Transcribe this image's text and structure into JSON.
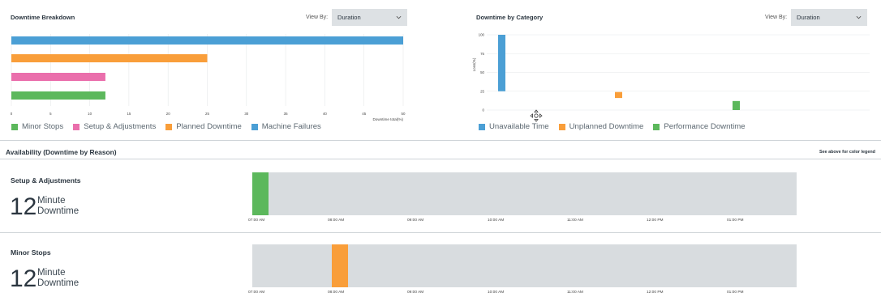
{
  "breakdown": {
    "title": "Downtime Breakdown",
    "view_by_label": "View By:",
    "view_by_value": "Duration",
    "chart_data": {
      "type": "bar",
      "orientation": "horizontal",
      "categories": [
        "Machine Failures",
        "Planned Downtime",
        "Setup & Adjustments",
        "Minor Stops"
      ],
      "values": [
        50,
        25,
        12,
        12
      ],
      "colors": [
        "#4b9fd5",
        "#f99e3a",
        "#ea6fac",
        "#5cb85c"
      ],
      "xlabel": "Downtime total(%)",
      "xlim": [
        0,
        50
      ],
      "xticks": [
        "0",
        "5",
        "10",
        "15",
        "20",
        "25",
        "30",
        "35",
        "40",
        "45",
        "50"
      ],
      "grid": true
    },
    "legend": [
      {
        "label": "Minor Stops",
        "color": "#5cb85c"
      },
      {
        "label": "Setup & Adjustments",
        "color": "#ea6fac"
      },
      {
        "label": "Planned Downtime",
        "color": "#f99e3a"
      },
      {
        "label": "Machine Failures",
        "color": "#4b9fd5"
      }
    ]
  },
  "category": {
    "title": "Downtime by Category",
    "view_by_label": "View By:",
    "view_by_value": "Duration",
    "chart_data": {
      "type": "bar",
      "series": [
        {
          "name": "Unavailable Time",
          "color": "#4b9fd5",
          "start": 25,
          "end": 100
        },
        {
          "name": "Unplanned Downtime",
          "color": "#f99e3a",
          "start": 16,
          "end": 24
        },
        {
          "name": "Performance Downtime",
          "color": "#5cb85c",
          "start": 0,
          "end": 12
        }
      ],
      "ylabel": "Loss(%)",
      "ylim": [
        0,
        100
      ],
      "yticks": [
        "100",
        "75",
        "50",
        "25",
        "0"
      ],
      "grid": true
    },
    "legend": [
      {
        "label": "Unavailable Time",
        "color": "#4b9fd5"
      },
      {
        "label": "Unplanned Downtime",
        "color": "#f99e3a"
      },
      {
        "label": "Performance Downtime",
        "color": "#5cb85c"
      }
    ]
  },
  "availability": {
    "title": "Availability (Downtime by Reason)",
    "legend_note": "See above for color legend",
    "time_labels": [
      "07:00 AM",
      "08:00 AM",
      "09:00 AM",
      "10:00 AM",
      "11:00 AM",
      "12:00 PM",
      "01:00 PM"
    ],
    "reasons": [
      {
        "name": "Setup & Adjustments",
        "value": "12",
        "unit_line1": "Minute",
        "unit_line2": "Downtime",
        "color": "#5cb85c",
        "start_hour": 7.0,
        "end_hour": 7.2
      },
      {
        "name": "Minor Stops",
        "value": "12",
        "unit_line1": "Minute",
        "unit_line2": "Downtime",
        "color": "#f99e3a",
        "start_hour": 8.0,
        "end_hour": 8.2
      }
    ]
  }
}
